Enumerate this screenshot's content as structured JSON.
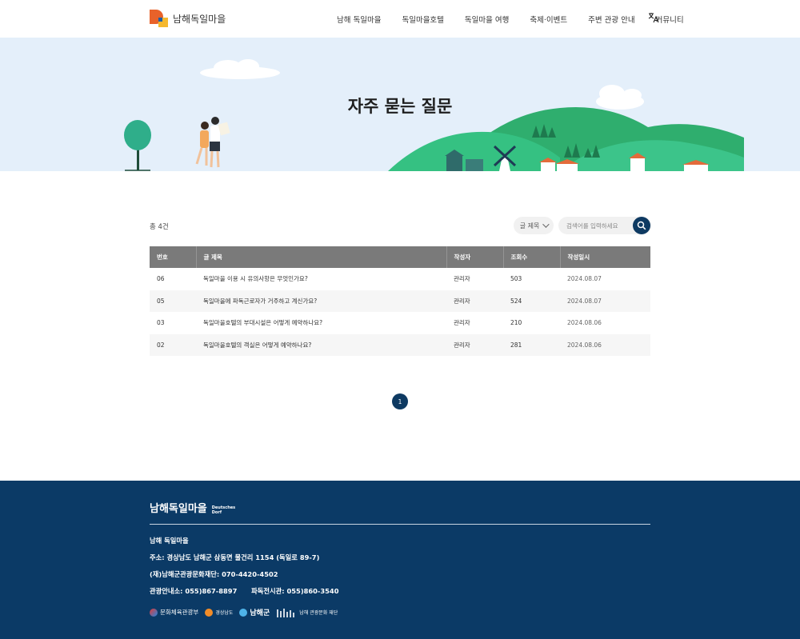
{
  "header": {
    "logo_text": "남해독일마을",
    "nav": [
      "남해 독일마을",
      "독일마을호텔",
      "독일마을 여행",
      "축제·이벤트",
      "주변 관광 안내",
      "커뮤니티"
    ],
    "translate_icon": "translate-icon"
  },
  "hero": {
    "title": "자주 묻는 질문"
  },
  "board": {
    "total_label": "총 4건",
    "filter_label": "글 제목",
    "search_placeholder": "검색어를 입력하세요",
    "columns": [
      "번호",
      "글 제목",
      "작성자",
      "조회수",
      "작성일시"
    ],
    "rows": [
      {
        "no": "06",
        "title": "독일마을 이용 시 유의사항은 무엇인가요?",
        "author": "관리자",
        "views": "503",
        "date": "2024.08.07"
      },
      {
        "no": "05",
        "title": "독일마을에 파독근로자가 거주하고 계신가요?",
        "author": "관리자",
        "views": "524",
        "date": "2024.08.07"
      },
      {
        "no": "03",
        "title": "독일마을호텔의 부대시설은 어떻게 예약하나요?",
        "author": "관리자",
        "views": "210",
        "date": "2024.08.06"
      },
      {
        "no": "02",
        "title": "독일마을호텔의 객실은 어떻게 예약하나요?",
        "author": "관리자",
        "views": "281",
        "date": "2024.08.06"
      }
    ],
    "pagination": {
      "current": "1"
    }
  },
  "footer": {
    "logo_main": "남해독일마을",
    "logo_sub_1": "Deutsches",
    "logo_sub_2": "Dorf",
    "org_name": "남해 독일마을",
    "address": "주소: 경상남도 남해군 삼동면 물건리 1154 (독일로 89-7)",
    "foundation": "(재)남해군관광문화재단: 070-4420-4502",
    "tour_info": "관광안내소: 055)867-8897",
    "exhibit": "파독전시관: 055)860-3540",
    "partners": [
      "문화체육관광부",
      "경상남도",
      "남해군",
      "남해 관광문화 재단"
    ]
  },
  "colors": {
    "navy": "#0b3a66",
    "hero_bg": "#e4effa",
    "hill_green": "#3cc48a",
    "table_header": "#7a7a7a"
  }
}
